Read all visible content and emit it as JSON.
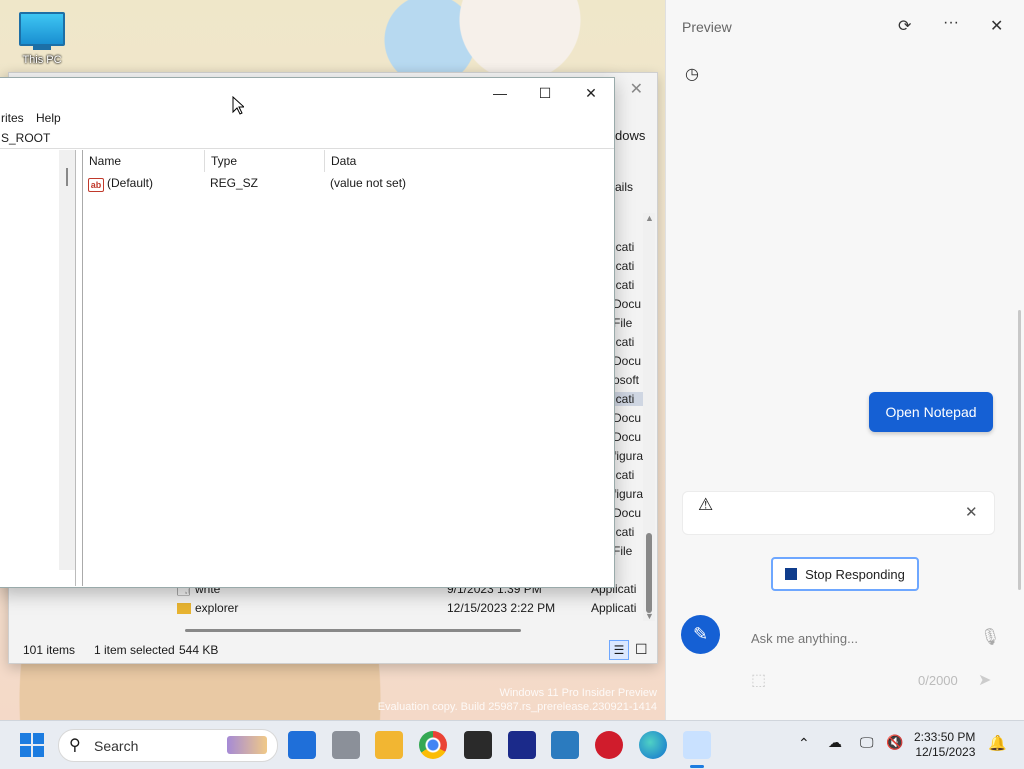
{
  "desktop": {
    "icon_label": "This PC",
    "watermark_line1": "Windows 11 Pro Insider Preview",
    "watermark_line2": "Evaluation copy. Build 25987.rs_prerelease.230921-1414"
  },
  "explorer": {
    "partial_text_windows": "dows",
    "partial_text_details": "ails",
    "type_fragments": [
      "icati",
      "icati",
      "icati",
      "Docu",
      "File",
      "icati",
      "Docu",
      "osoft",
      "icati",
      "Docu",
      "Docu",
      "figura",
      "icati",
      "figura",
      "Docu",
      "icati",
      "File"
    ],
    "rows": [
      {
        "name": "write",
        "date": "9/1/2023 1:39 PM",
        "type": "Applicati"
      },
      {
        "name": "explorer",
        "date": "12/15/2023 2:22 PM",
        "type": "Applicati"
      }
    ],
    "status_items": "101 items",
    "status_selected": "1 item selected",
    "status_size": "544 KB"
  },
  "regedit": {
    "menu_favorites": "rites",
    "menu_help": "Help",
    "address": "S_ROOT",
    "columns": {
      "name": "Name",
      "type": "Type",
      "data": "Data"
    },
    "row": {
      "name": "(Default)",
      "type": "REG_SZ",
      "data": "(value not set)"
    },
    "icon_text": "ab"
  },
  "panel": {
    "title": "Preview",
    "open_notepad_label": "Open Notepad",
    "stop_label": "Stop Responding",
    "ask_placeholder": "Ask me anything...",
    "counter": "0/2000"
  },
  "taskbar": {
    "search_label": "Search",
    "time": "2:33:50 PM",
    "date": "12/15/2023"
  },
  "colors": {
    "accent": "#1560d4",
    "stop_square": "#0f3c8c"
  }
}
